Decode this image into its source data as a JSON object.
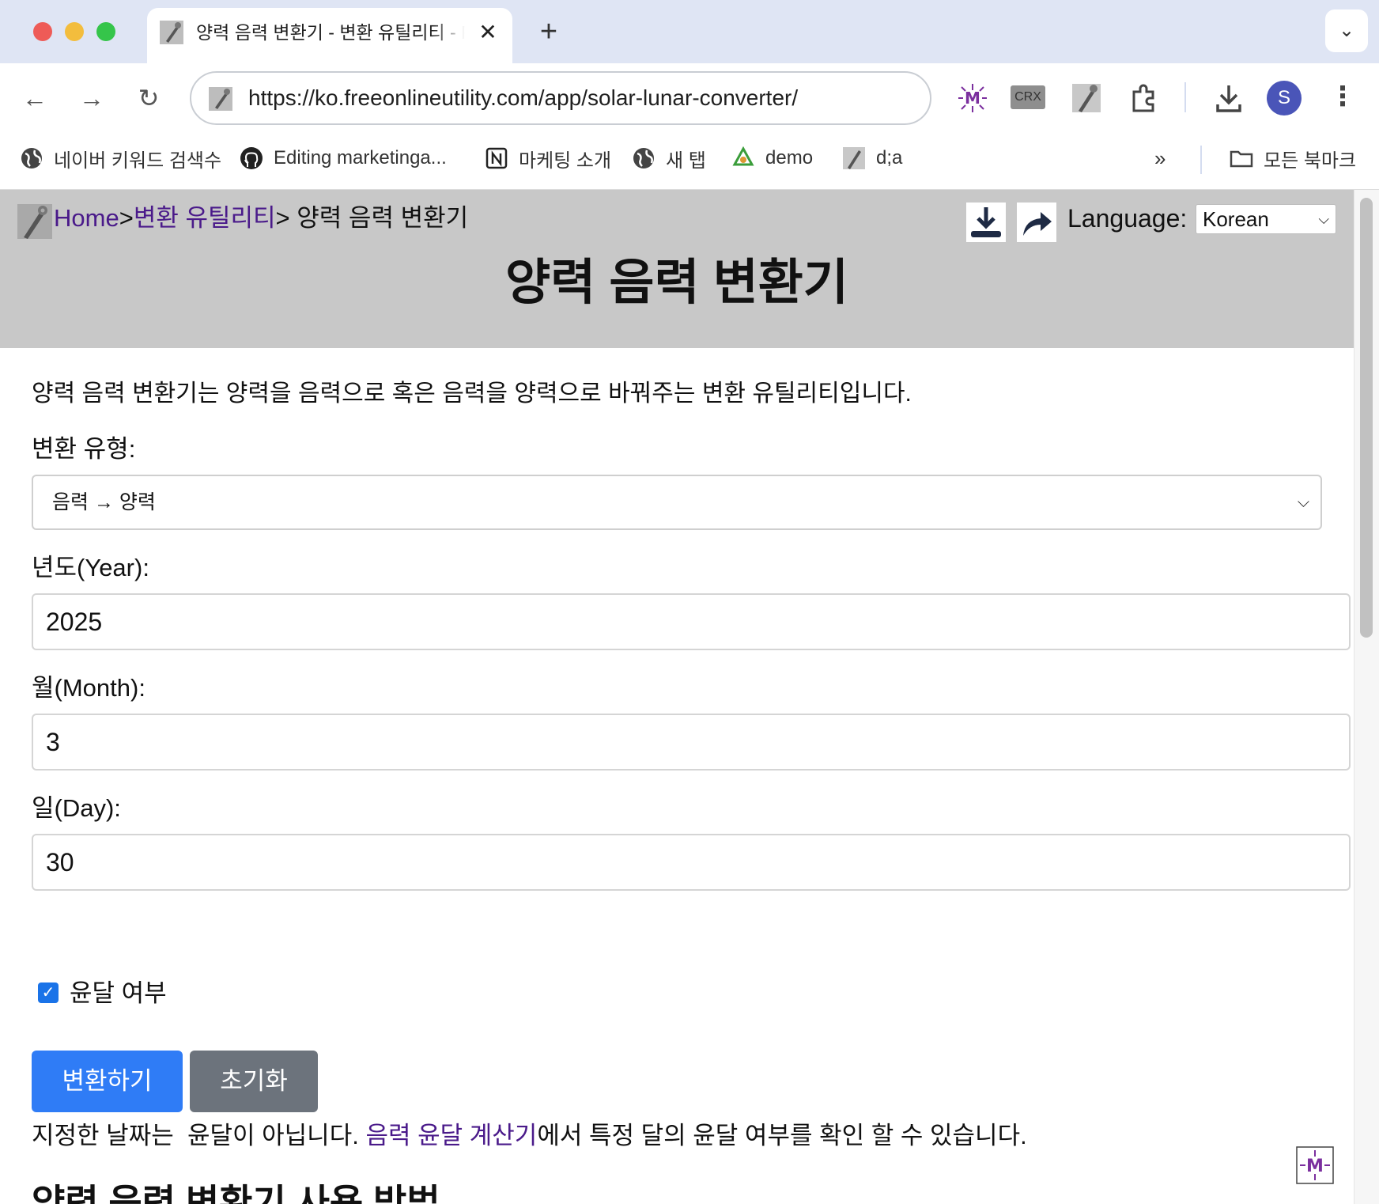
{
  "browser": {
    "tab_title": "양력 음력 변환기 - 변환 유틸리티 - Free Online Utility",
    "tab_close": "✕",
    "new_tab": "+",
    "url": "https://ko.freeonlineutility.com/app/solar-lunar-converter/",
    "bookmarks": [
      {
        "label": "네이버 키워드 검색수",
        "icon": "globe-icon"
      },
      {
        "label": "Editing marketinga...",
        "icon": "github-icon"
      },
      {
        "label": "마케팅 소개",
        "icon": "notion-icon"
      },
      {
        "label": "새 탭",
        "icon": "globe-icon"
      },
      {
        "label": "demo",
        "icon": "recycle-icon"
      },
      {
        "label": "d;a",
        "icon": "wrench-icon"
      }
    ],
    "all_bookmarks": "모든 북마크",
    "profile_initial": "S",
    "extensions": [
      "m-star-icon",
      "crx-icon",
      "wrench-icon",
      "puzzle-icon"
    ],
    "crx_label": "CRX"
  },
  "header": {
    "breadcrumb": {
      "home": "Home",
      "sep1": ">",
      "category": "변환 유틸리티",
      "sep2": "> ",
      "current": "양력 음력 변환기"
    },
    "language_label": "Language:",
    "language_value": "Korean",
    "title": "양력 음력 변환기"
  },
  "main": {
    "intro": "양력 음력 변환기는 양력을 음력으로 혹은 음력을 양력으로 바꿔주는 변환 유틸리티입니다.",
    "conversion_type_label": "변환 유형:",
    "conversion_type_value": "음력 → 양력",
    "year_label": "년도(Year):",
    "year_value": "2025",
    "month_label": "월(Month):",
    "month_value": "3",
    "day_label": "일(Day):",
    "day_value": "30",
    "leap_checkbox_label": "윤달 여부",
    "leap_checked": true,
    "convert_button": "변환하기",
    "reset_button": "초기화",
    "result_prefix": "지정한 날짜는  윤달이 아닙니다. ",
    "result_link": "음력 윤달 계산기",
    "result_suffix": "에서 특정 달의 윤달 여부를 확인 할 수 있습니다.",
    "section_title": "양력 음력 변환기 사용 방법"
  },
  "colors": {
    "header_bg": "#c8c8c8",
    "link": "#4a1a8a",
    "primary_button": "#2f7cf6",
    "secondary_button": "#6c737c",
    "tabbar_bg": "#dfe5f4"
  }
}
